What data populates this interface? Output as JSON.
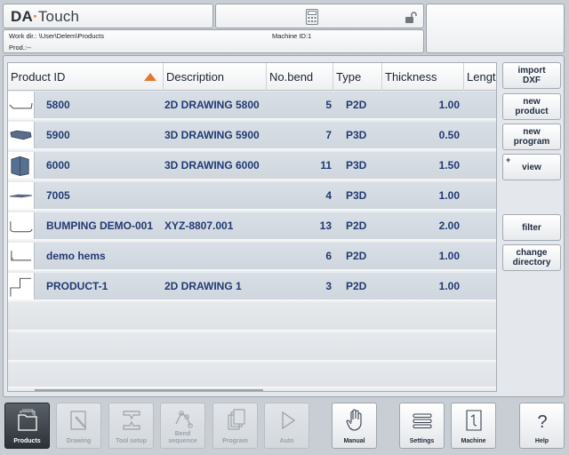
{
  "header": {
    "logo_bold": "DA",
    "logo_dot": "·",
    "logo_rest": "Touch",
    "work_dir": "Work dir.: \\User\\Delem\\Products",
    "machine_id": "Machine ID:1",
    "prod": "Prod.:--"
  },
  "table": {
    "columns": [
      "Product ID",
      "Description",
      "No.bend",
      "Type",
      "Thickness",
      "Length"
    ],
    "sorted_column": "Product ID",
    "rows": [
      {
        "id": "5800",
        "description": "2D DRAWING 5800",
        "bends": "5",
        "type": "P2D",
        "thickness": "1.00"
      },
      {
        "id": "5900",
        "description": "3D DRAWING 5900",
        "bends": "7",
        "type": "P3D",
        "thickness": "0.50"
      },
      {
        "id": "6000",
        "description": "3D DRAWING 6000",
        "bends": "11",
        "type": "P3D",
        "thickness": "1.50"
      },
      {
        "id": "7005",
        "description": "",
        "bends": "4",
        "type": "P3D",
        "thickness": "1.00"
      },
      {
        "id": "BUMPING DEMO-001",
        "description": "XYZ-8807.001",
        "bends": "13",
        "type": "P2D",
        "thickness": "2.00"
      },
      {
        "id": "demo hems",
        "description": "",
        "bends": "6",
        "type": "P2D",
        "thickness": "1.00"
      },
      {
        "id": "PRODUCT-1",
        "description": "2D DRAWING 1",
        "bends": "3",
        "type": "P2D",
        "thickness": "1.00"
      }
    ]
  },
  "side_buttons": {
    "import_dxf": [
      "import",
      "DXF"
    ],
    "new_product": [
      "new",
      "product"
    ],
    "new_program": [
      "new",
      "program"
    ],
    "view_plus": "+",
    "view": "view",
    "filter": "filter",
    "change_directory": [
      "change",
      "directory"
    ]
  },
  "nav": {
    "products": "Products",
    "drawing": "Drawing",
    "tool_setup": "Tool setup",
    "bend_sequence": [
      "Bend",
      "sequence"
    ],
    "program": "Program",
    "auto": "Auto",
    "manual": "Manual",
    "settings": "Settings",
    "machine": "Machine",
    "help": "Help"
  },
  "colors": {
    "accent": "#e2782a",
    "row_text": "#223a73"
  }
}
